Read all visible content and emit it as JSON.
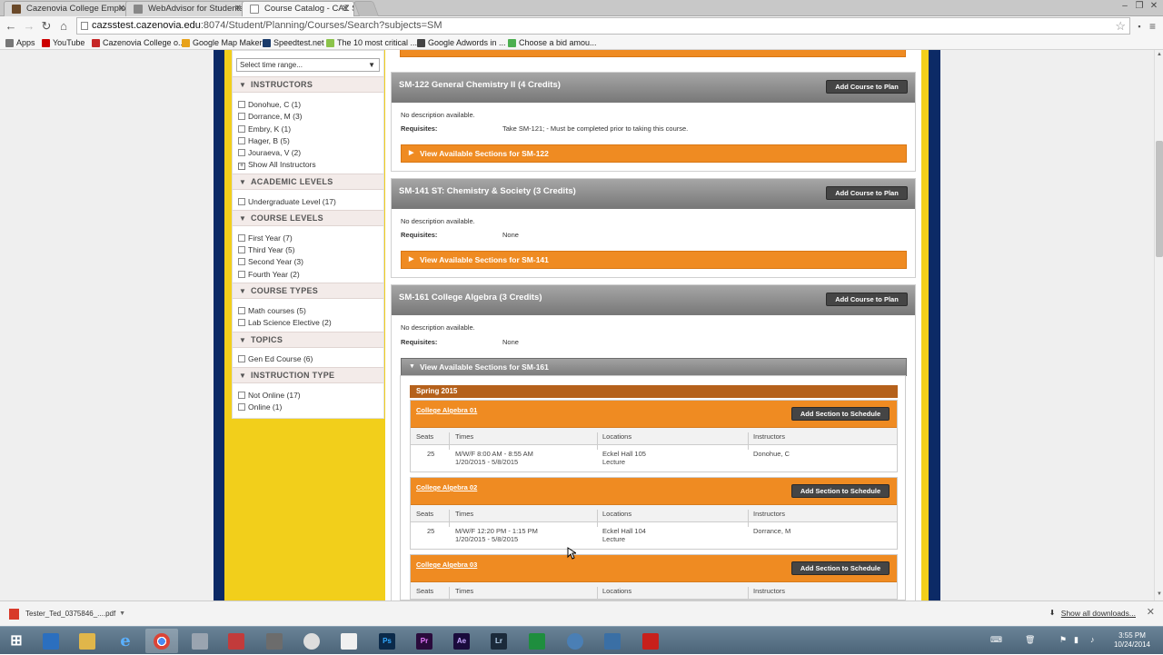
{
  "browser": {
    "tabs": [
      {
        "title": "Cazenovia College Emplo"
      },
      {
        "title": "WebAdvisor for Students"
      },
      {
        "title": "Course Catalog - CAZ Self"
      }
    ],
    "url_host": "cazsstest.cazenovia.edu",
    "url_path": ":8074/Student/Planning/Courses/Search?subjects=SM",
    "bookmarks": [
      {
        "label": "Apps",
        "color": "#777777"
      },
      {
        "label": "YouTube",
        "color": "#cc0000"
      },
      {
        "label": "Cazenovia College o...",
        "color": "#c62828"
      },
      {
        "label": "Google Map Maker",
        "color": "#e8a21a"
      },
      {
        "label": "Speedtest.net",
        "color": "#1b3c6b"
      },
      {
        "label": "The 10 most critical ...",
        "color": "#8bc34a"
      },
      {
        "label": "Google Adwords in ...",
        "color": "#444444"
      },
      {
        "label": "Choose a bid amou...",
        "color": "#4caf50"
      }
    ]
  },
  "sidebar": {
    "time_range_placeholder": "Select time range...",
    "facets": [
      {
        "heading": "INSTRUCTORS",
        "items": [
          "Donohue, C (1)",
          "Dorrance, M (3)",
          "Embry, K (1)",
          "Hager, B (5)",
          "Jouraeva, V (2)"
        ],
        "more": "Show All Instructors"
      },
      {
        "heading": "ACADEMIC LEVELS",
        "items": [
          "Undergraduate Level (17)"
        ]
      },
      {
        "heading": "COURSE LEVELS",
        "items": [
          "First Year (7)",
          "Third Year (5)",
          "Second Year (3)",
          "Fourth Year (2)"
        ]
      },
      {
        "heading": "COURSE TYPES",
        "items": [
          "Math courses (5)",
          "Lab Science Elective (2)"
        ]
      },
      {
        "heading": "TOPICS",
        "items": [
          "Gen Ed Course (6)"
        ]
      },
      {
        "heading": "INSTRUCTION TYPE",
        "items": [
          "Not Online (17)",
          "Online (1)"
        ]
      }
    ]
  },
  "courses": [
    {
      "title": "SM-122 General Chemistry II (4 Credits)",
      "add_label": "Add Course to Plan",
      "description": "No description available.",
      "requisites_label": "Requisites:",
      "requisites": "Take SM-121; - Must be completed prior to taking this course.",
      "view_label": "View Available Sections for SM-122"
    },
    {
      "title": "SM-141 ST: Chemistry & Society (3 Credits)",
      "add_label": "Add Course to Plan",
      "description": "No description available.",
      "requisites_label": "Requisites:",
      "requisites": "None",
      "view_label": "View Available Sections for SM-141"
    },
    {
      "title": "SM-161 College Algebra (3 Credits)",
      "add_label": "Add Course to Plan",
      "description": "No description available.",
      "requisites_label": "Requisites:",
      "requisites": "None",
      "view_label": "View Available Sections for SM-161"
    }
  ],
  "sections": {
    "term": "Spring 2015",
    "add_label": "Add Section to Schedule",
    "columns": [
      "Seats",
      "Times",
      "Locations",
      "Instructors"
    ],
    "items": [
      {
        "name": "College Algebra 01",
        "seats": "25",
        "time": "M/W/F 8:00 AM - 8:55 AM",
        "dates": "1/20/2015 - 5/8/2015",
        "location": "Eckel Hall 105",
        "type": "Lecture",
        "instructor": "Donohue, C"
      },
      {
        "name": "College Algebra 02",
        "seats": "25",
        "time": "M/W/F 12:20 PM - 1:15 PM",
        "dates": "1/20/2015 - 5/8/2015",
        "location": "Eckel Hall 104",
        "type": "Lecture",
        "instructor": "Dorrance, M"
      },
      {
        "name": "College Algebra 03",
        "seats": "",
        "time": "",
        "dates": "",
        "location": "",
        "type": "",
        "instructor": ""
      }
    ]
  },
  "downloads": {
    "file": "Tester_Ted_0375846_....pdf",
    "show_all": "Show all downloads..."
  },
  "taskbar": {
    "apps": [
      {
        "label": "",
        "color": "#1e90d6"
      },
      {
        "label": "",
        "color": "#2b6fbf"
      },
      {
        "label": "",
        "color": "#e0b64a"
      },
      {
        "label": "e",
        "color": "#1d7bd3"
      },
      {
        "label": "",
        "color": "#d43b2b"
      },
      {
        "label": "",
        "color": "#9aa4b0"
      },
      {
        "label": "",
        "color": "#c23b3b"
      },
      {
        "label": "",
        "color": "#6c6c6c"
      },
      {
        "label": "",
        "color": "#333333"
      },
      {
        "label": "",
        "color": "#8b5a2b"
      },
      {
        "label": "Ps",
        "color": "#0b2a4a"
      },
      {
        "label": "Pr",
        "color": "#2a0b3c"
      },
      {
        "label": "Ae",
        "color": "#1a0b3c"
      },
      {
        "label": "Lr",
        "color": "#1b2a3a"
      },
      {
        "label": "",
        "color": "#1e8e3e"
      },
      {
        "label": "",
        "color": "#4a7fb5"
      },
      {
        "label": "",
        "color": "#3a6fa5"
      },
      {
        "label": "",
        "color": "#c8201b"
      }
    ],
    "time": "3:55 PM",
    "date": "10/24/2014"
  }
}
